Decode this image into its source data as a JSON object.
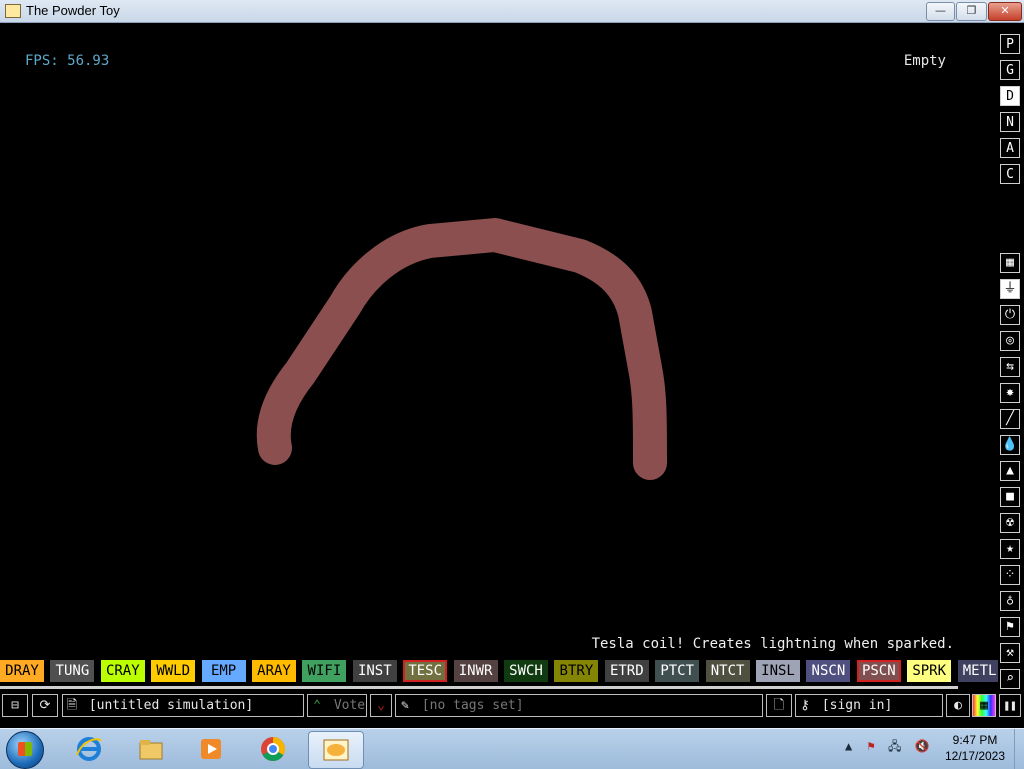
{
  "window": {
    "title": "The Powder Toy",
    "min": "—",
    "max": "❐",
    "close": "✕"
  },
  "hud": {
    "fps": "FPS: 56.93",
    "hover": "Empty",
    "tooltip": "Tesla coil! Creates lightning when sparked."
  },
  "render_buttons": [
    {
      "label": "P",
      "active": false
    },
    {
      "label": "G",
      "active": false
    },
    {
      "label": "D",
      "active": true
    },
    {
      "label": "N",
      "active": false
    },
    {
      "label": "A",
      "active": false
    },
    {
      "label": "C",
      "active": false
    }
  ],
  "menu_icons": [
    {
      "name": "walls-icon",
      "glyph": "▦",
      "active": false
    },
    {
      "name": "electronics-icon",
      "glyph": "⏚",
      "active": true
    },
    {
      "name": "powered-icon",
      "glyph": "⏻",
      "active": false
    },
    {
      "name": "sensors-icon",
      "glyph": "◎",
      "active": false
    },
    {
      "name": "force-icon",
      "glyph": "⇆",
      "active": false
    },
    {
      "name": "explosives-icon",
      "glyph": "✸",
      "active": false
    },
    {
      "name": "gases-icon",
      "glyph": "╱",
      "active": false
    },
    {
      "name": "liquids-icon",
      "glyph": "💧",
      "active": false
    },
    {
      "name": "powders-icon",
      "glyph": "▲",
      "active": false
    },
    {
      "name": "solids-icon",
      "glyph": "■",
      "active": false
    },
    {
      "name": "radioactive-icon",
      "glyph": "☢",
      "active": false
    },
    {
      "name": "special-icon",
      "glyph": "★",
      "active": false
    },
    {
      "name": "life-icon",
      "glyph": "⁘",
      "active": false
    },
    {
      "name": "tools-icon",
      "glyph": "♁",
      "active": false
    },
    {
      "name": "favorites-icon",
      "glyph": "⚑",
      "active": false
    },
    {
      "name": "decoration-icon",
      "glyph": "⚒",
      "active": false
    },
    {
      "name": "search-icon",
      "glyph": "⌕",
      "active": false
    }
  ],
  "elements": [
    {
      "label": "DRAY",
      "bg": "#ffaa22",
      "fg": "#000"
    },
    {
      "label": "TUNG",
      "bg": "#505050",
      "fg": "#fff"
    },
    {
      "label": "CRAY",
      "bg": "#bbff00",
      "fg": "#000"
    },
    {
      "label": "WWLD",
      "bg": "#ffcc00",
      "fg": "#000"
    },
    {
      "label": "EMP",
      "bg": "#66aaff",
      "fg": "#000"
    },
    {
      "label": "ARAY",
      "bg": "#ffbb00",
      "fg": "#000"
    },
    {
      "label": "WIFI",
      "bg": "#40a060",
      "fg": "#000"
    },
    {
      "label": "INST",
      "bg": "#404040",
      "fg": "#fff"
    },
    {
      "label": "TESC",
      "bg": "#707040",
      "fg": "#fff",
      "selected": true
    },
    {
      "label": "INWR",
      "bg": "#544141",
      "fg": "#fff"
    },
    {
      "label": "SWCH",
      "bg": "#103b11",
      "fg": "#fff"
    },
    {
      "label": "BTRY",
      "bg": "#858505",
      "fg": "#000"
    },
    {
      "label": "ETRD",
      "bg": "#404040",
      "fg": "#fff"
    },
    {
      "label": "PTCT",
      "bg": "#405050",
      "fg": "#fff"
    },
    {
      "label": "NTCT",
      "bg": "#505040",
      "fg": "#fff"
    },
    {
      "label": "INSL",
      "bg": "#9ea3b6",
      "fg": "#000"
    },
    {
      "label": "NSCN",
      "bg": "#505080",
      "fg": "#fff"
    },
    {
      "label": "PSCN",
      "bg": "#805050",
      "fg": "#fff",
      "selected": true
    },
    {
      "label": "SPRK",
      "bg": "#ffff80",
      "fg": "#000"
    },
    {
      "label": "METL",
      "bg": "#404060",
      "fg": "#fff"
    }
  ],
  "bottom": {
    "open": "⊟",
    "reload": "⟳",
    "save_icon": "🗎",
    "save_name": "[untitled simulation]",
    "vote": "Vote",
    "vote_up": "⌃",
    "vote_down": "⌄",
    "tags_icon": "✎",
    "tags": "[no tags set]",
    "new_sim": "🗋",
    "login_icon": "⚷",
    "login": "[sign in]",
    "settings": "◐",
    "render": "▦",
    "pause": "❚❚"
  },
  "taskbar": {
    "time": "9:47 PM",
    "date": "12/17/2023"
  },
  "colors": {
    "stroke": "#8b4f4f"
  }
}
